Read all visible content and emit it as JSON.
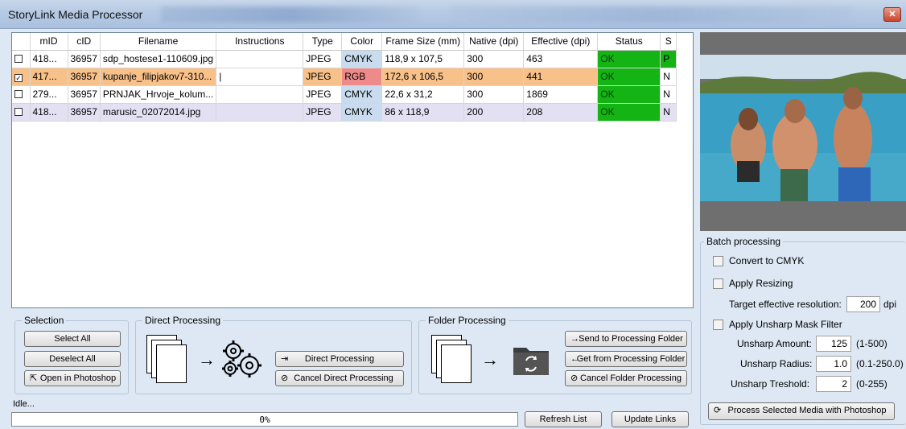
{
  "window": {
    "title": "StoryLink Media Processor"
  },
  "table": {
    "headers": [
      "",
      "mID",
      "cID",
      "Filename",
      "Instructions",
      "Type",
      "Color",
      "Frame Size (mm)",
      "Native (dpi)",
      "Effective (dpi)",
      "Status",
      "S"
    ],
    "rows": [
      {
        "checked": "",
        "mid": "418...",
        "cid": "36957",
        "filename": "sdp_hostese1-110609.jpg",
        "instructions": "",
        "type": "JPEG",
        "color": "CMYK",
        "frame": "118,9 x 107,5",
        "native": "300",
        "effective": "463",
        "status": "OK",
        "s": "P"
      },
      {
        "checked": "✓",
        "mid": "417...",
        "cid": "36957",
        "filename": "kupanje_filipjakov7-310...",
        "instructions": "|",
        "type": "JPEG",
        "color": "RGB",
        "frame": "172,6 x 106,5",
        "native": "300",
        "effective": "441",
        "status": "OK",
        "s": "N"
      },
      {
        "checked": "",
        "mid": "279...",
        "cid": "36957",
        "filename": "PRNJAK_Hrvoje_kolum...",
        "instructions": "",
        "type": "JPEG",
        "color": "CMYK",
        "frame": "22,6 x 31,2",
        "native": "300",
        "effective": "1869",
        "status": "OK",
        "s": "N"
      },
      {
        "checked": "",
        "mid": "418...",
        "cid": "36957",
        "filename": "marusic_02072014.jpg",
        "instructions": "",
        "type": "JPEG",
        "color": "CMYK",
        "frame": "86 x 118,9",
        "native": "200",
        "effective": "208",
        "status": "OK",
        "s": "N"
      }
    ]
  },
  "selection": {
    "title": "Selection",
    "select_all": "Select All",
    "deselect_all": "Deselect All",
    "open_photoshop": "Open in Photoshop"
  },
  "direct": {
    "title": "Direct Processing",
    "direct_btn": "Direct Processing",
    "cancel_btn": "Cancel Direct Processing"
  },
  "folder": {
    "title": "Folder Processing",
    "send_btn": "Send to Processing Folder",
    "get_btn": "Get from Processing Folder",
    "cancel_btn": "Cancel Folder Processing"
  },
  "batch": {
    "title": "Batch processing",
    "convert_cmyk": "Convert to CMYK",
    "apply_resizing": "Apply Resizing",
    "target_res_label": "Target effective resolution:",
    "target_res_value": "200",
    "target_res_unit": "dpi",
    "unsharp_filter": "Apply Unsharp Mask Filter",
    "amount_label": "Unsharp Amount:",
    "amount_value": "125",
    "amount_range": "(1-500)",
    "radius_label": "Unsharp Radius:",
    "radius_value": "1.0",
    "radius_range": "(0.1-250.0)",
    "threshold_label": "Unsharp Treshold:",
    "threshold_value": "2",
    "threshold_range": "(0-255)",
    "process_btn": "Process Selected Media with Photoshop"
  },
  "status": {
    "text": "Idle...",
    "progress_text": "0%",
    "progress_value": 0
  },
  "footer": {
    "refresh": "Refresh List",
    "update_links": "Update Links"
  }
}
